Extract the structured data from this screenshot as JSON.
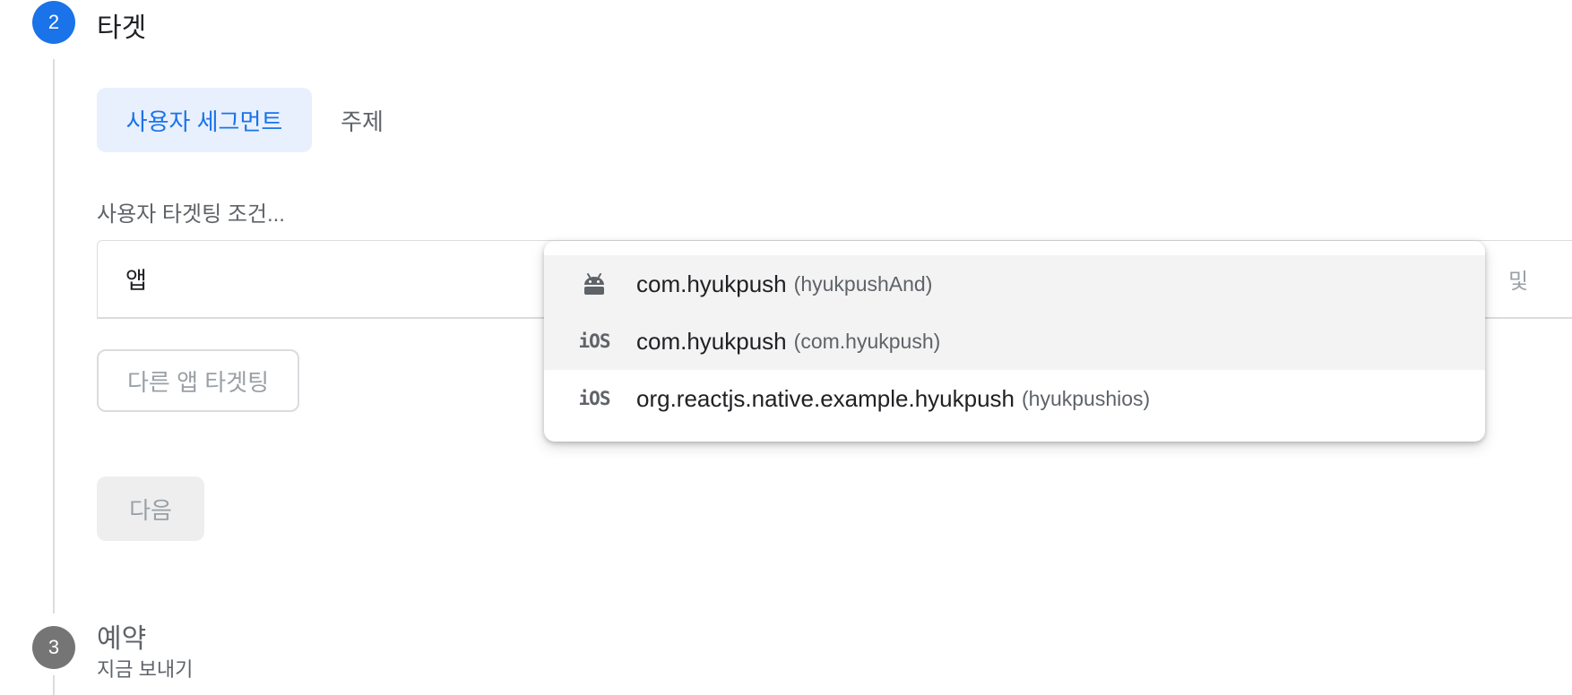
{
  "step_target": {
    "number": "2",
    "title": "타겟"
  },
  "target_type_tabs": {
    "segment": "사용자 세그먼트",
    "topic": "주제"
  },
  "segment": {
    "label": "사용자 타겟팅 조건...",
    "field_label": "앱",
    "and_label": "및",
    "other_app_button": "다른 앱 타겟팅"
  },
  "next_button": "다음",
  "app_dropdown": {
    "options": [
      {
        "platform_icon": "android-icon",
        "name": "com.hyukpush",
        "nickname": "(hyukpushAnd)",
        "highlighted": true
      },
      {
        "platform_icon": "ios-icon",
        "name": "com.hyukpush",
        "nickname": "(com.hyukpush)",
        "highlighted": true
      },
      {
        "platform_icon": "ios-icon",
        "name": "org.reactjs.native.example.hyukpush",
        "nickname": "(hyukpushios)",
        "highlighted": false
      }
    ]
  },
  "step_schedule": {
    "number": "3",
    "title": "예약",
    "subtitle": "지금 보내기"
  },
  "colors": {
    "accent": "#1a73e8",
    "accent_bg": "#e8f0fe",
    "step_inactive": "#757575",
    "highlight_row": "#f3f3f3"
  }
}
